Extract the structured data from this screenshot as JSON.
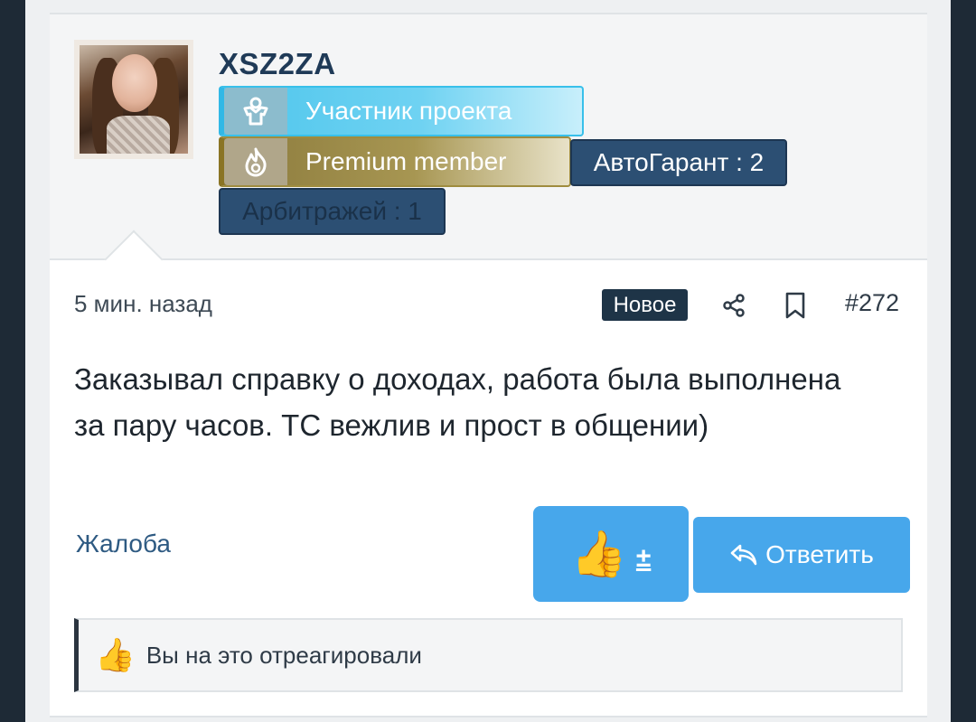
{
  "author": {
    "username": "XSZ2ZA"
  },
  "banners": {
    "participant": {
      "label": "Участник проекта",
      "icon": "user-shirt-icon"
    },
    "premium": {
      "label": "Premium member",
      "icon": "flame-icon"
    }
  },
  "tags": {
    "guarantee": "АвтоГарант : 2",
    "arbitrage": "Арбитражей : 1"
  },
  "post": {
    "time": "5 мин. назад",
    "badge": "Новое",
    "number": "#272",
    "body": "Заказывал справку о доходах, работа была выполнена за пару часов. ТС вежлив и прост в общении)"
  },
  "actions": {
    "report": "Жалоба",
    "like_emoji": "👍",
    "like_toggle": "±",
    "reply": "Ответить",
    "share_icon": "share-icon",
    "bookmark_icon": "bookmark-icon"
  },
  "reactions": {
    "emoji": "👍",
    "text": "Вы на это отреагировали"
  },
  "colors": {
    "accent_blue": "#47a7eb",
    "username": "#1f3a57",
    "tag_bg": "#2c4f73",
    "participant": "#4ec6ec",
    "premium": "#8b7a3c"
  }
}
